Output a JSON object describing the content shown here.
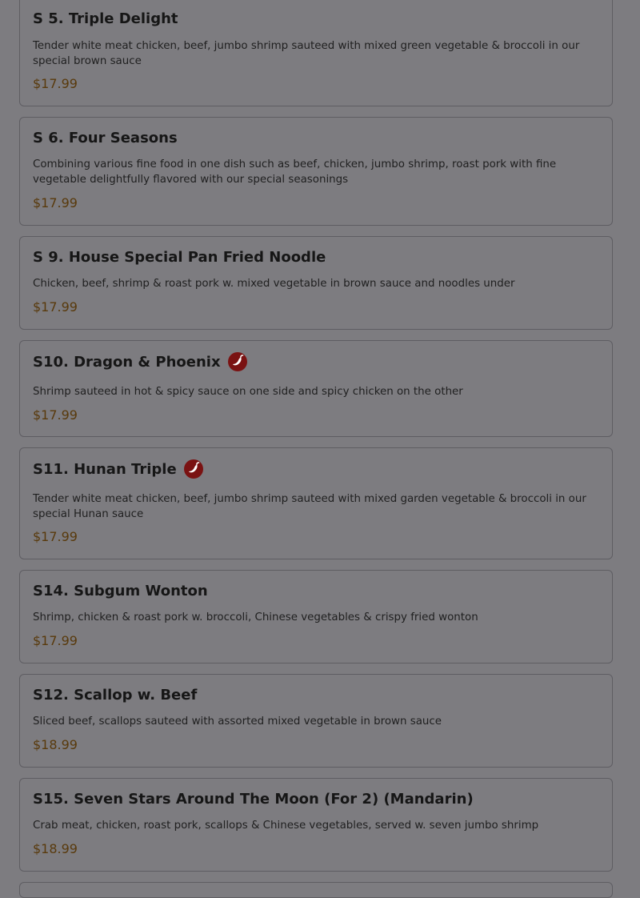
{
  "items": [
    {
      "name": "S 5. Triple Delight",
      "description": "Tender white meat chicken, beef, jumbo shrimp sauteed with mixed green vegetable & broccoli in our special brown sauce",
      "price": "$17.99",
      "spicy": false
    },
    {
      "name": "S 6. Four Seasons",
      "description": "Combining various fine food in one dish such as beef, chicken, jumbo shrimp, roast pork with fine vegetable delightfully flavored with our special seasonings",
      "price": "$17.99",
      "spicy": false
    },
    {
      "name": "S 9. House Special Pan Fried Noodle",
      "description": "Chicken, beef, shrimp & roast pork w. mixed vegetable in brown sauce and noodles under",
      "price": "$17.99",
      "spicy": false
    },
    {
      "name": "S10. Dragon & Phoenix",
      "description": "Shrimp sauteed in hot & spicy sauce on one side and spicy chicken on the other",
      "price": "$17.99",
      "spicy": true
    },
    {
      "name": "S11. Hunan Triple",
      "description": "Tender white meat chicken, beef, jumbo shrimp sauteed with mixed garden vegetable & broccoli in our special Hunan sauce",
      "price": "$17.99",
      "spicy": true
    },
    {
      "name": "S14. Subgum Wonton",
      "description": "Shrimp, chicken & roast pork w. broccoli, Chinese vegetables & crispy fried wonton",
      "price": "$17.99",
      "spicy": false
    },
    {
      "name": "S12. Scallop w. Beef",
      "description": "Sliced beef, scallops sauteed with assorted mixed vegetable in brown sauce",
      "price": "$18.99",
      "spicy": false
    },
    {
      "name": "S15. Seven Stars Around The Moon (For 2) (Mandarin)",
      "description": "Crab meat, chicken, roast pork, scallops & Chinese vegetables, served w. seven jumbo shrimp",
      "price": "$18.99",
      "spicy": false
    }
  ],
  "icons": {
    "spicy": "chili-pepper-icon"
  },
  "colors": {
    "overlay": "#7d7c80",
    "price": "#593a0c",
    "spicy_badge": "#7a1212"
  }
}
